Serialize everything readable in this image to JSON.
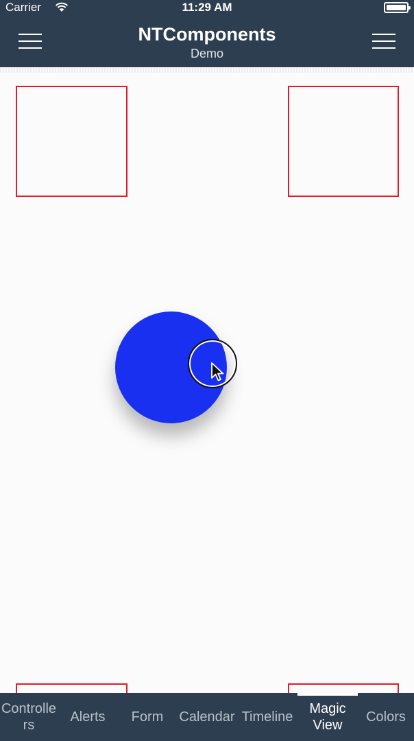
{
  "status_bar": {
    "carrier": "Carrier",
    "time": "11:29 AM",
    "wifi_icon": "wifi-icon",
    "battery_icon": "battery-icon"
  },
  "nav": {
    "title": "NTComponents",
    "subtitle": "Demo",
    "left_icon": "menu-icon",
    "right_icon": "menu-icon"
  },
  "colors": {
    "nav_background": "#2d3e50",
    "box_border": "#e21b2b",
    "circle": "#1930f0",
    "tab_active": "#ffffff",
    "tab_inactive": "#b8c1cb"
  },
  "tabs": [
    {
      "label": "Controlle\nrs",
      "active": false
    },
    {
      "label": "Alerts",
      "active": false
    },
    {
      "label": "Form",
      "active": false
    },
    {
      "label": "Calendar",
      "active": false
    },
    {
      "label": "Timeline",
      "active": false
    },
    {
      "label": "Magic\nView",
      "active": true
    },
    {
      "label": "Colors",
      "active": false
    }
  ]
}
